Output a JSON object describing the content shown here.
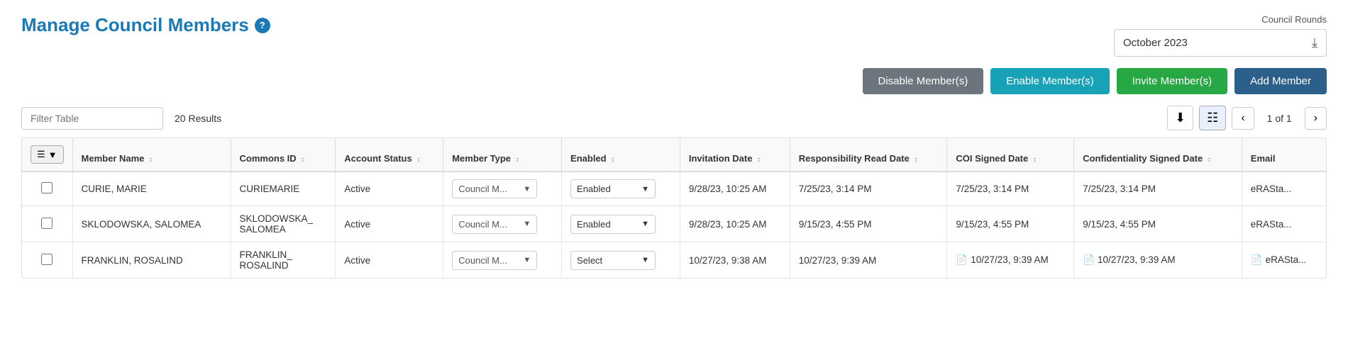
{
  "page": {
    "title": "Manage Council Members",
    "help_icon": "?",
    "council_rounds_label": "Council Rounds",
    "council_rounds_value": "October 2023"
  },
  "action_buttons": {
    "disable": "Disable Member(s)",
    "enable": "Enable Member(s)",
    "invite": "Invite Member(s)",
    "add": "Add Member"
  },
  "filter": {
    "placeholder": "Filter Table",
    "results": "20 Results"
  },
  "pagination": {
    "current": "1 of 1"
  },
  "table": {
    "columns": [
      "Member Name",
      "Commons ID",
      "Account Status",
      "Member Type",
      "Enabled",
      "Invitation Date",
      "Responsibility Read Date",
      "COI Signed Date",
      "Confidentiality Signed Date",
      "Email"
    ],
    "rows": [
      {
        "member_name": "CURIE, MARIE",
        "commons_id": "CURIEMARIE",
        "account_status": "Active",
        "member_type": "Council M...",
        "enabled": "Enabled",
        "invitation_date": "9/28/23, 10:25 AM",
        "responsibility_read_date": "7/25/23, 3:14 PM",
        "coi_signed_date": "7/25/23, 3:14 PM",
        "confidentiality_signed_date": "7/25/23, 3:14 PM",
        "email": "eRASta...",
        "has_doc_coi": false,
        "has_doc_conf": false,
        "enabled_type": "enabled"
      },
      {
        "member_name": "SKLODOWSKA, SALOMEA",
        "commons_id": "SKLODOWSKA_\nSALOMEA",
        "account_status": "Active",
        "member_type": "Council M...",
        "enabled": "Enabled",
        "invitation_date": "9/28/23, 10:25 AM",
        "responsibility_read_date": "9/15/23, 4:55 PM",
        "coi_signed_date": "9/15/23, 4:55 PM",
        "confidentiality_signed_date": "9/15/23, 4:55 PM",
        "email": "eRASta...",
        "has_doc_coi": false,
        "has_doc_conf": false,
        "enabled_type": "enabled"
      },
      {
        "member_name": "FRANKLIN, ROSALIND",
        "commons_id": "FRANKLIN_\nROSALIND",
        "account_status": "Active",
        "member_type": "Council M...",
        "enabled": "Select",
        "invitation_date": "10/27/23, 9:38 AM",
        "responsibility_read_date": "10/27/23, 9:39 AM",
        "coi_signed_date": "10/27/23, 9:39 AM",
        "confidentiality_signed_date": "10/27/23, 9:39 AM",
        "email": "eRASta...",
        "has_doc_coi": true,
        "has_doc_conf": true,
        "enabled_type": "select"
      }
    ]
  }
}
